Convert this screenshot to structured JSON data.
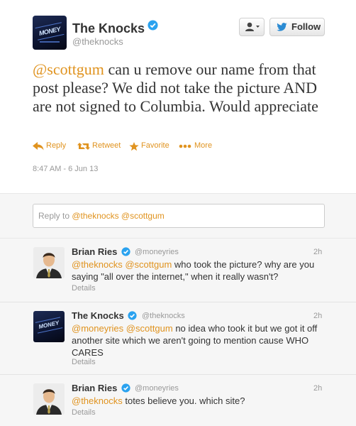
{
  "colors": {
    "accent": "#e0931f",
    "link_blue": "#2b8bd3",
    "verified": "#2aa2ef"
  },
  "main_tweet": {
    "author_name": "The Knocks",
    "author_handle": "@theknocks",
    "follow_label": "Follow",
    "text_mention": "@scottgum",
    "text_body": " can u remove our name from that post please? We did not take the picture AND are not signed to Columbia.  Would appreciate",
    "actions": {
      "reply": "Reply",
      "retweet": "Retweet",
      "favorite": "Favorite",
      "more": "More"
    },
    "timestamp": "8:47 AM - 6 Jun 13",
    "icons": [
      "user-dropdown-icon",
      "twitter-bird-icon",
      "reply-icon",
      "retweet-icon",
      "star-icon",
      "more-dots-icon",
      "verified-badge-icon"
    ]
  },
  "reply_box": {
    "prefix": "Reply to ",
    "mentions": "@theknocks @scottgum"
  },
  "replies": [
    {
      "name": "Brian Ries",
      "handle": "@moneyries",
      "time": "2h",
      "mentions": "@theknocks @scottgum",
      "text": " who took the picture? why are you saying \"all over the internet,\" when it really wasn't?",
      "details": "Details"
    },
    {
      "name": "The Knocks",
      "handle": "@theknocks",
      "time": "2h",
      "mentions": "@moneyries @scottgum",
      "text": " no idea who took it but we got it off another site which we aren't going to mention cause WHO CARES",
      "details": "Details"
    },
    {
      "name": "Brian Ries",
      "handle": "@moneyries",
      "time": "2h",
      "mentions": "@theknocks",
      "text": " totes believe you. which site?",
      "details": "Details"
    }
  ]
}
